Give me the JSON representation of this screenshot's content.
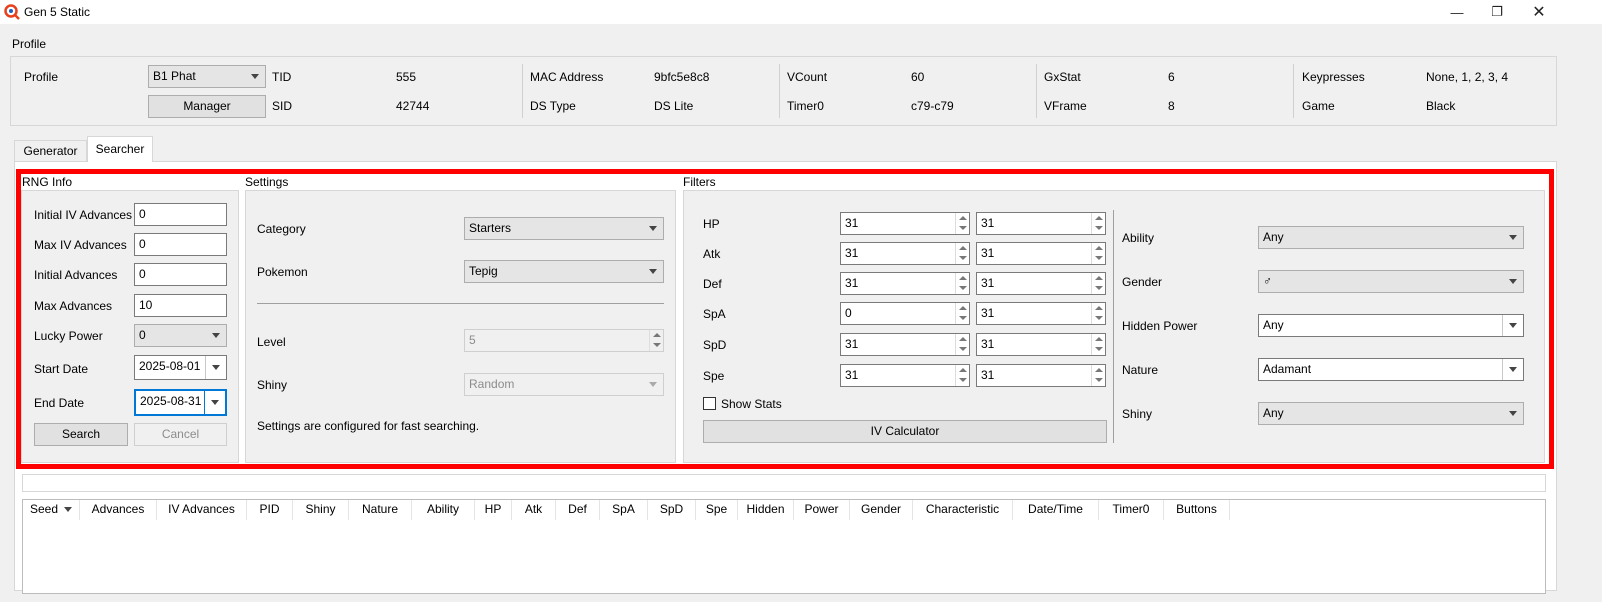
{
  "window": {
    "title": "Gen 5 Static"
  },
  "profile_section": {
    "title": "Profile",
    "profile_label": "Profile",
    "profile_value": "B1 Phat",
    "manager_button": "Manager",
    "tid_label": "TID",
    "tid_value": "555",
    "sid_label": "SID",
    "sid_value": "42744",
    "mac_label": "MAC Address",
    "mac_value": "9bfc5e8c8",
    "dstype_label": "DS Type",
    "dstype_value": "DS Lite",
    "vcount_label": "VCount",
    "vcount_value": "60",
    "timer0_label": "Timer0",
    "timer0_value": "c79-c79",
    "gxstat_label": "GxStat",
    "gxstat_value": "6",
    "vframe_label": "VFrame",
    "vframe_value": "8",
    "keypresses_label": "Keypresses",
    "keypresses_value": "None, 1, 2, 3, 4",
    "game_label": "Game",
    "game_value": "Black"
  },
  "tabs": [
    {
      "label": "Generator"
    },
    {
      "label": "Searcher"
    }
  ],
  "active_tab": "Searcher",
  "rng_info": {
    "title": "RNG Info",
    "initial_iv_advances_label": "Initial IV Advances",
    "initial_iv_advances": "0",
    "max_iv_advances_label": "Max IV Advances",
    "max_iv_advances": "0",
    "initial_advances_label": "Initial Advances",
    "initial_advances": "0",
    "max_advances_label": "Max Advances",
    "max_advances": "10",
    "lucky_power_label": "Lucky Power",
    "lucky_power": "0",
    "start_date_label": "Start Date",
    "start_date": "2025-08-01",
    "end_date_label": "End Date",
    "end_date": "2025-08-31",
    "search_button": "Search",
    "cancel_button": "Cancel"
  },
  "settings": {
    "title": "Settings",
    "category_label": "Category",
    "category": "Starters",
    "pokemon_label": "Pokemon",
    "pokemon": "Tepig",
    "level_label": "Level",
    "level": "5",
    "shiny_label": "Shiny",
    "shiny": "Random",
    "note": "Settings are configured for fast searching."
  },
  "filters": {
    "title": "Filters",
    "iv_rows": [
      {
        "label": "HP",
        "min": "31",
        "max": "31"
      },
      {
        "label": "Atk",
        "min": "31",
        "max": "31"
      },
      {
        "label": "Def",
        "min": "31",
        "max": "31"
      },
      {
        "label": "SpA",
        "min": "0",
        "max": "31"
      },
      {
        "label": "SpD",
        "min": "31",
        "max": "31"
      },
      {
        "label": "Spe",
        "min": "31",
        "max": "31"
      }
    ],
    "show_stats_label": "Show Stats",
    "show_stats_checked": false,
    "iv_calculator_button": "IV Calculator",
    "ability_label": "Ability",
    "ability": "Any",
    "gender_label": "Gender",
    "gender": "♂",
    "hidden_power_label": "Hidden Power",
    "hidden_power": "Any",
    "nature_label": "Nature",
    "nature": "Adamant",
    "shiny_label": "Shiny",
    "shiny": "Any"
  },
  "results_table": {
    "columns": [
      "Seed",
      "Advances",
      "IV Advances",
      "PID",
      "Shiny",
      "Nature",
      "Ability",
      "HP",
      "Atk",
      "Def",
      "SpA",
      "SpD",
      "Spe",
      "Hidden",
      "Power",
      "Gender",
      "Characteristic",
      "Date/Time",
      "Timer0",
      "Buttons"
    ],
    "rows": []
  },
  "colors": {
    "highlight_border": "#ff0000",
    "window_bg": "#f0f0f0"
  }
}
